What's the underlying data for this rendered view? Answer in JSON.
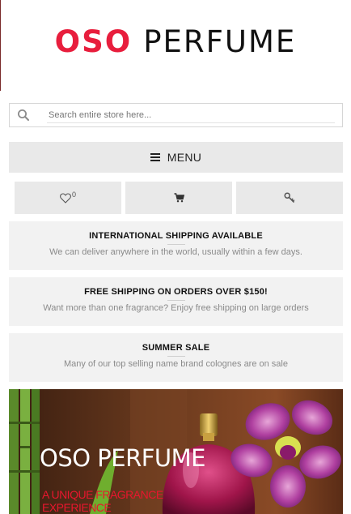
{
  "header": {
    "logo_red": "OSO",
    "logo_black": "PERFUME"
  },
  "search": {
    "placeholder": "Search entire store here...",
    "value": "",
    "icon": "search-icon"
  },
  "nav": {
    "menu_label": "MENU",
    "menu_icon": "hamburger-icon"
  },
  "actions": {
    "wishlist_icon": "heart-icon",
    "wishlist_count": "0",
    "cart_icon": "cart-icon",
    "account_icon": "key-icon"
  },
  "promos": [
    {
      "title": "INTERNATIONAL SHIPPING AVAILABLE",
      "text": "We can deliver anywhere in the world, usually within a few days."
    },
    {
      "title": "FREE SHIPPING ON ORDERS OVER $150!",
      "text": "Want more than one fragrance?  Enjoy free shipping on large orders"
    },
    {
      "title": "SUMMER SALE",
      "text": "Many of our top selling name brand colognes are on sale"
    }
  ],
  "banner": {
    "title": "OSO PERFUME",
    "subtitle": "A UNIQUE FRAGRANCE EXPERIENCE"
  },
  "colors": {
    "brand_red": "#e81e3d",
    "panel_gray": "#e9e9e9",
    "promo_bg": "#f2f2f2",
    "banner_subtitle": "#e8162e"
  }
}
